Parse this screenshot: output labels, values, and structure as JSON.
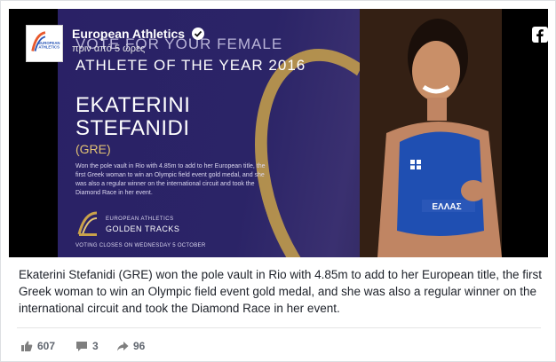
{
  "page": {
    "name": "European Athletics",
    "time": "πριν από 5 ώρες",
    "avatar_text": [
      "EUROPEAN",
      "ATHLETICS"
    ]
  },
  "image": {
    "headline_line1": "VOTE FOR YOUR FEMALE",
    "headline_line2": "ATHLETE OF THE YEAR 2016",
    "athlete_first": "EKATERINI",
    "athlete_last": "STEFANIDI",
    "country": "(GRE)",
    "blurb": "Won the pole vault in Rio with 4.85m to add to her European title, the first Greek woman to win an Olympic field event gold medal, and she was also a regular winner on the international circuit and took the Diamond Race in her event.",
    "brand_line1": "EUROPEAN ATHLETICS",
    "brand_line2": "GOLDEN TRACKS",
    "voting": "VOTING CLOSES ON WEDNESDAY 5 OCTOBER",
    "bib_text": "ΕΛΛΑΣ"
  },
  "caption": "Ekaterini Stefanidi (GRE) won the pole vault in Rio with 4.85m to add to her European title, the first Greek woman to win an Olympic field event gold medal, and she was also a regular winner on the international circuit and took the Diamond Race in her event.",
  "stats": {
    "likes": "607",
    "comments": "3",
    "shares": "96"
  },
  "colors": {
    "brand_purple": "#2b2467",
    "gold": "#c9a24a",
    "text": "#1d2129",
    "muted": "#616770"
  },
  "icons": [
    "verified-icon",
    "facebook-icon",
    "like-icon",
    "comment-icon",
    "share-icon"
  ]
}
